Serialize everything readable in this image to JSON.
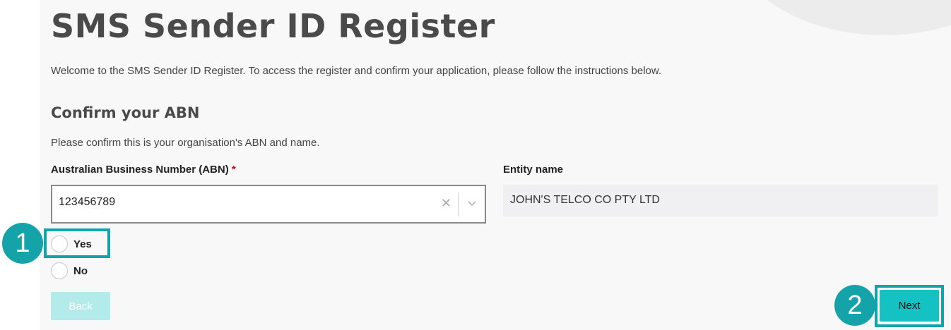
{
  "page": {
    "title": "SMS Sender ID Register",
    "intro": "Welcome to the SMS Sender ID Register. To access the register and confirm your application, please follow the instructions below."
  },
  "section": {
    "title": "Confirm your ABN",
    "description": "Please confirm this is your organisation's ABN and name."
  },
  "abn": {
    "label": "Australian Business Number (ABN)",
    "required_marker": "*",
    "value": "123456789",
    "clear_icon": "close-icon",
    "dropdown_icon": "chevron-down-icon"
  },
  "entity": {
    "label": "Entity name",
    "value": "JOHN'S TELCO CO PTY LTD"
  },
  "confirm_options": [
    {
      "label": "Yes",
      "selected": false
    },
    {
      "label": "No",
      "selected": false
    }
  ],
  "buttons": {
    "back": "Back",
    "next": "Next"
  },
  "annotations": {
    "step1": "1",
    "step2": "2"
  },
  "colors": {
    "accent": "#14a3a8",
    "primary_button": "#14c1c3",
    "disabled_button": "#b3ebeb",
    "required": "#d0021b"
  }
}
